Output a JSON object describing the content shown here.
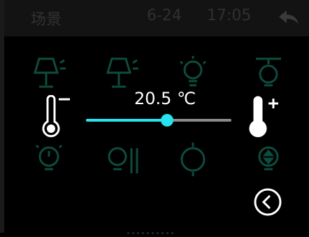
{
  "topbar": {
    "title": "场景",
    "date": "6-24",
    "time": "17:05"
  },
  "icons": {
    "back": "back-arrow-icon",
    "thermo_minus": "thermometer-minus-icon",
    "thermo_plus": "thermometer-plus-icon",
    "nav": "chevron-left-circle-icon",
    "background": [
      "table-lamp-icon",
      "table-lamp-icon",
      "bulb-icon",
      "ceiling-light-icon",
      "bulb-timer-icon",
      "bulb-adjust-icon",
      "spotlight-icon",
      "bulb-updown-icon"
    ]
  },
  "thermostat": {
    "value_label": "20.5 ℃",
    "level": 0.56
  },
  "colors": {
    "accent": "#27e3f0",
    "dim_icon": "#0e4c3e"
  }
}
